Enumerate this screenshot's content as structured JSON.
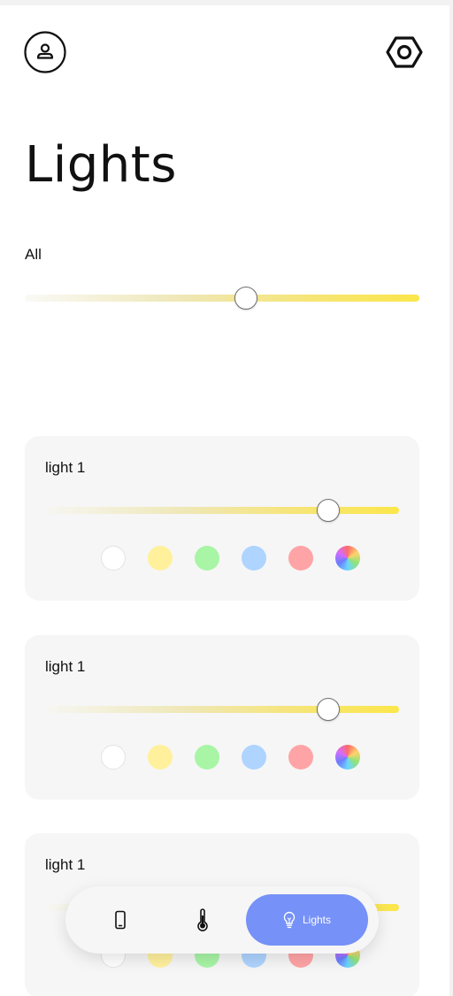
{
  "header": {
    "profile_icon": "person-icon",
    "settings_icon": "hexagon-settings-icon",
    "title": "Lights"
  },
  "all": {
    "label": "All",
    "brightness": 0.56
  },
  "lights": [
    {
      "label": "light 1",
      "brightness": 0.8,
      "colors": [
        "#ffffff",
        "#fff19c",
        "#a8f5a6",
        "#aed4ff",
        "#ffa4a6",
        "rainbow"
      ]
    },
    {
      "label": "light 1",
      "brightness": 0.8,
      "colors": [
        "#ffffff",
        "#fff19c",
        "#a8f5a6",
        "#aed4ff",
        "#ffa4a6",
        "rainbow"
      ]
    },
    {
      "label": "light 1",
      "brightness": 0.8,
      "colors": [
        "#ffffff",
        "#fff19c",
        "#a8f5a6",
        "#aed4ff",
        "#ffa4a6",
        "rainbow"
      ]
    }
  ],
  "navbar": {
    "items": [
      {
        "icon": "phone-icon"
      },
      {
        "icon": "thermometer-icon"
      },
      {
        "icon": "lightbulb-icon",
        "label": "Lights",
        "active": true
      }
    ]
  },
  "colors": {
    "accent": "#7691f7",
    "card_bg": "#f6f6f6",
    "slider_end": "#fbe64a"
  }
}
